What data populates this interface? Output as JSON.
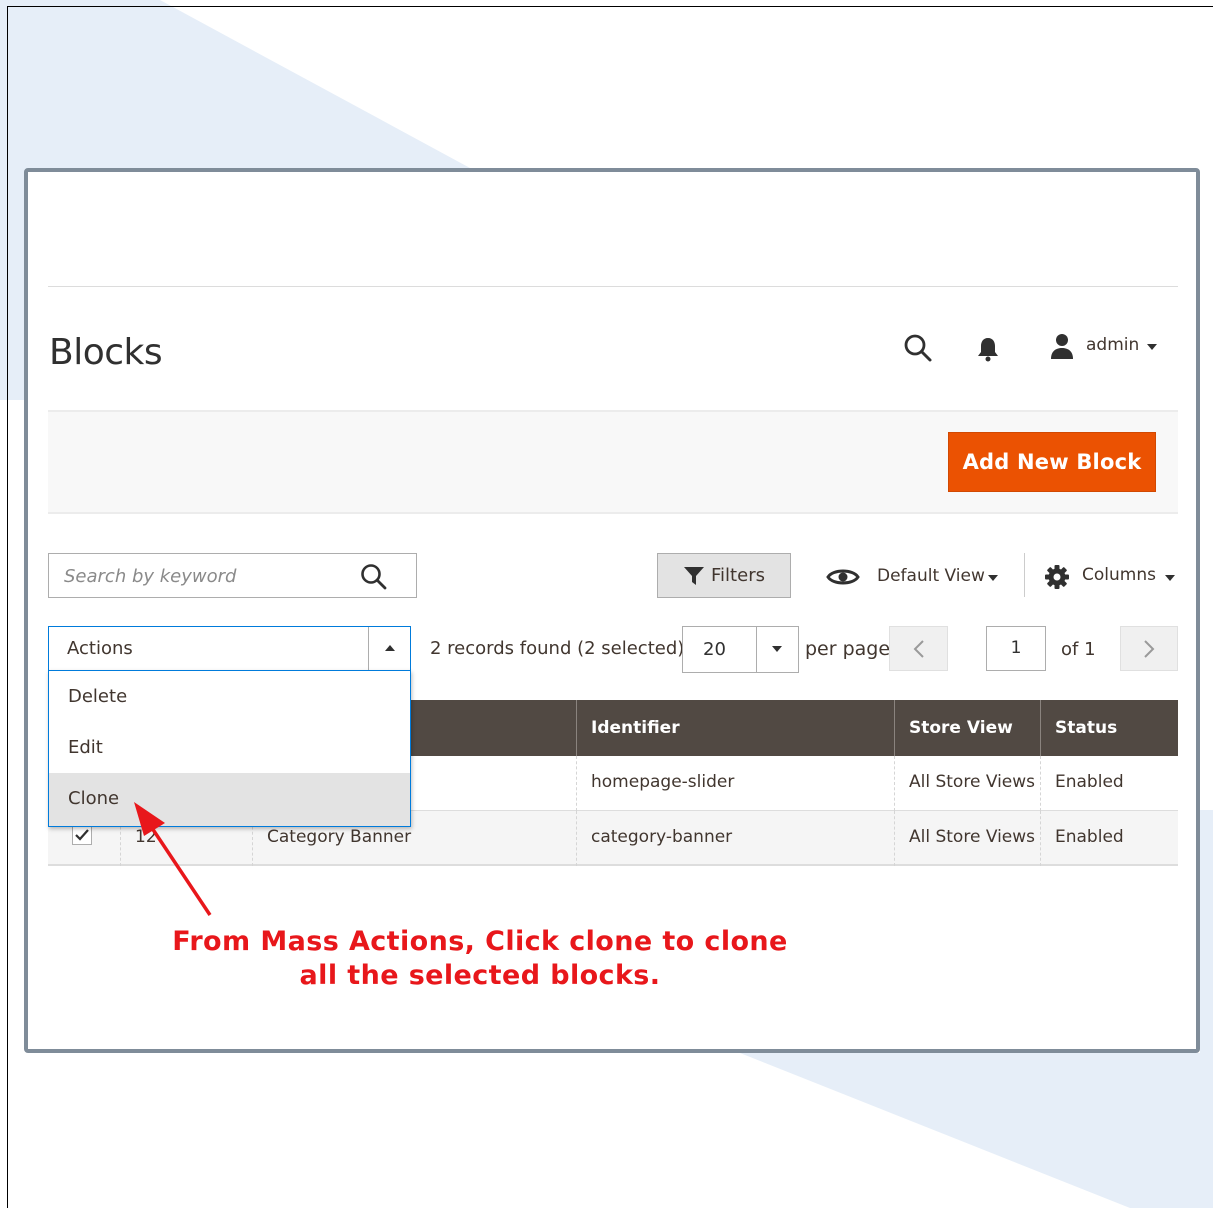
{
  "page": {
    "title": "Blocks"
  },
  "header": {
    "user_name": "admin",
    "icons": [
      "search-icon",
      "bell-icon",
      "user-icon"
    ]
  },
  "toolbar": {
    "add_button_label": "Add New Block",
    "search_placeholder": "Search by keyword",
    "filters_label": "Filters",
    "view_label": "Default View",
    "columns_label": "Columns"
  },
  "mass_actions": {
    "label": "Actions",
    "options": [
      "Delete",
      "Edit",
      "Clone"
    ],
    "highlighted": "Clone"
  },
  "pagination": {
    "records_text": "2 records found (2 selected)",
    "per_page_value": "20",
    "per_page_label": "per page",
    "current_page": "1",
    "of_text": "of 1"
  },
  "table": {
    "columns": [
      "Identifier",
      "Store View",
      "Status"
    ],
    "rows": [
      {
        "id": "",
        "title": "",
        "identifier": "homepage-slider",
        "store_view": "All Store Views",
        "status": "Enabled",
        "checked": true
      },
      {
        "id": "12",
        "title": "Category Banner",
        "identifier": "category-banner",
        "store_view": "All Store Views",
        "status": "Enabled",
        "checked": true
      }
    ]
  },
  "annotation": {
    "line1": "From Mass Actions, Click clone to clone",
    "line2": "all the selected blocks."
  },
  "colors": {
    "accent": "#eb5202",
    "table_header": "#514943",
    "annotation": "#e8171b",
    "focus_border": "#007bdb",
    "frame": "#7f8c99",
    "background_deco": "#e6eef8"
  }
}
